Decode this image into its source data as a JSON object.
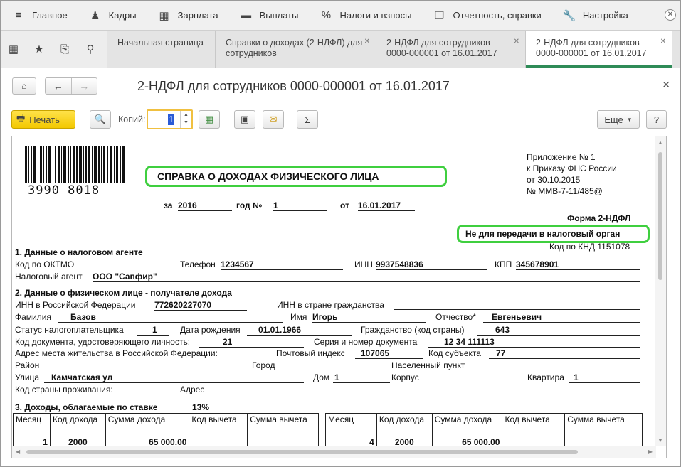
{
  "menu": {
    "items": [
      {
        "icon": "≡",
        "label": "Главное"
      },
      {
        "icon": "♟",
        "label": "Кадры"
      },
      {
        "icon": "▦",
        "label": "Зарплата"
      },
      {
        "icon": "▬",
        "label": "Выплаты"
      },
      {
        "icon": "%",
        "label": "Налоги и взносы"
      },
      {
        "icon": "❐",
        "label": "Отчетность, справки"
      },
      {
        "icon": "🔧",
        "label": "Настройка"
      }
    ]
  },
  "tabs": [
    {
      "label": "Начальная страница",
      "closable": false
    },
    {
      "label": "Справки о доходах (2-НДФЛ) для сотрудников",
      "closable": true
    },
    {
      "label": "2-НДФЛ для сотрудников 0000-000001 от 16.01.2017",
      "closable": true
    },
    {
      "label": "2-НДФЛ для сотрудников 0000-000001 от 16.01.2017",
      "closable": true
    }
  ],
  "document": {
    "title": "2-НДФЛ для сотрудников 0000-000001 от 16.01.2017"
  },
  "toolbar": {
    "print_label": "Печать",
    "copies_label": "Копий:",
    "copies_value": "1",
    "more_label": "Еще",
    "help_label": "?"
  },
  "report": {
    "barcode_number": "3990 8018",
    "title": "СПРАВКА О ДОХОДАХ ФИЗИЧЕСКОГО ЛИЦА",
    "appendix": [
      "Приложение № 1",
      "к Приказу ФНС России",
      "от 30.10.2015",
      "№ ММВ-7-11/485@"
    ],
    "za_label": "за",
    "year": "2016",
    "god_no_label": "год №",
    "number": "1",
    "ot_label": "от",
    "date": "16.01.2017",
    "form_label": "Форма 2-НДФЛ",
    "not_for_tax": "Не для передачи в налоговый орган",
    "knd": "Код по КНД 1151078",
    "section1": {
      "heading": "1. Данные о налоговом агенте",
      "oktmo_label": "Код по ОКТМО",
      "phone_label": "Телефон",
      "phone": "1234567",
      "inn_label": "ИНН",
      "inn": "9937548836",
      "kpp_label": "КПП",
      "kpp": "345678901",
      "agent_label": "Налоговый агент",
      "agent": "ООО \"Сапфир\""
    },
    "section2": {
      "heading": "2. Данные о физическом лице - получателе дохода",
      "inn_rf_label": "ИНН в Российской Федерации",
      "inn_rf": "772620227070",
      "inn_foreign_label": "ИНН в стране гражданства",
      "surname_label": "Фамилия",
      "surname": "Базов",
      "name_label": "Имя",
      "name": "Игорь",
      "patronymic_label": "Отчество*",
      "patronymic": "Евгеньевич",
      "status_label": "Статус налогоплательщика",
      "status": "1",
      "birth_label": "Дата рождения",
      "birth": "01.01.1966",
      "citizenship_label": "Гражданство (код страны)",
      "citizenship": "643",
      "doc_code_label": "Код документа, удостоверяющего личность:",
      "doc_code": "21",
      "doc_series_label": "Серия и номер документа",
      "doc_series": "12 34 111113",
      "address_label": "Адрес места жительства в Российской Федерации:",
      "postcode_label": "Почтовый индекс",
      "postcode": "107065",
      "region_label": "Код субъекта",
      "region": "77",
      "district_label": "Район",
      "city_label": "Город",
      "settlement_label": "Населенный пункт",
      "street_label": "Улица",
      "street": "Камчатская ул",
      "house_label": "Дом",
      "house": "1",
      "building_label": "Корпус",
      "flat_label": "Квартира",
      "flat": "1",
      "country_label": "Код страны проживания:",
      "addr_label": "Адрес"
    },
    "section3": {
      "heading": "3. Доходы, облагаемые по ставке",
      "rate": "13%",
      "col_month": "Месяц",
      "col_income_code": "Код дохода",
      "col_income_sum": "Сумма дохода",
      "col_deduction_code": "Код вычета",
      "col_deduction_sum": "Сумма вычета",
      "left_row": {
        "month": "1",
        "code": "2000",
        "sum": "65 000.00"
      },
      "right_row": {
        "month": "4",
        "code": "2000",
        "sum": "65 000.00"
      }
    }
  }
}
